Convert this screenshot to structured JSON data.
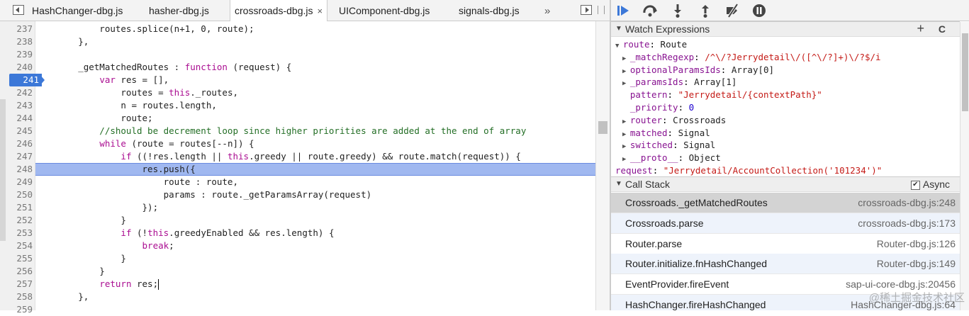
{
  "tabs": [
    {
      "label": "HashChanger-dbg.js",
      "active": false
    },
    {
      "label": "hasher-dbg.js",
      "active": false
    },
    {
      "label": "crossroads-dbg.js",
      "active": true
    },
    {
      "label": "UIComponent-dbg.js",
      "active": false
    },
    {
      "label": "signals-dbg.js",
      "active": false
    }
  ],
  "tab_close": "×",
  "tab_overflow": "»",
  "breakpoint_line": "241",
  "current_line": "248",
  "code": {
    "lines": [
      {
        "n": "237",
        "segs": [
          [
            "",
            "            routes.splice(n+1, 0, route);"
          ]
        ]
      },
      {
        "n": "238",
        "segs": [
          [
            "",
            "        },"
          ]
        ]
      },
      {
        "n": "239",
        "segs": [
          [
            "",
            ""
          ]
        ]
      },
      {
        "n": "240",
        "segs": [
          [
            "",
            "        _getMatchedRoutes : "
          ],
          [
            "kw",
            "function"
          ],
          [
            "",
            " (request) {"
          ]
        ]
      },
      {
        "n": "241",
        "segs": [
          [
            "",
            "            "
          ],
          [
            "kw",
            "var"
          ],
          [
            "",
            " res = [],"
          ]
        ]
      },
      {
        "n": "242",
        "segs": [
          [
            "",
            "                routes = "
          ],
          [
            "kw",
            "this"
          ],
          [
            "",
            "._routes,"
          ]
        ]
      },
      {
        "n": "243",
        "segs": [
          [
            "",
            "                n = routes.length,"
          ]
        ]
      },
      {
        "n": "244",
        "segs": [
          [
            "",
            "                route;"
          ]
        ]
      },
      {
        "n": "245",
        "segs": [
          [
            "cm",
            "            //should be decrement loop since higher priorities are added at the end of array"
          ]
        ]
      },
      {
        "n": "246",
        "segs": [
          [
            "",
            "            "
          ],
          [
            "kw",
            "while"
          ],
          [
            "",
            " (route = routes[--n]) {"
          ]
        ]
      },
      {
        "n": "247",
        "segs": [
          [
            "",
            "                "
          ],
          [
            "kw",
            "if"
          ],
          [
            "",
            " ((!res.length || "
          ],
          [
            "kw",
            "this"
          ],
          [
            "",
            ".greedy || route.greedy) && route.match(request)) {"
          ]
        ]
      },
      {
        "n": "248",
        "segs": [
          [
            "",
            "                    res.push({"
          ]
        ]
      },
      {
        "n": "249",
        "segs": [
          [
            "",
            "                        route : route,"
          ]
        ]
      },
      {
        "n": "250",
        "segs": [
          [
            "",
            "                        params : route._getParamsArray(request)"
          ]
        ]
      },
      {
        "n": "251",
        "segs": [
          [
            "",
            "                    });"
          ]
        ]
      },
      {
        "n": "252",
        "segs": [
          [
            "",
            "                }"
          ]
        ]
      },
      {
        "n": "253",
        "segs": [
          [
            "",
            "                "
          ],
          [
            "kw",
            "if"
          ],
          [
            "",
            " (!"
          ],
          [
            "kw",
            "this"
          ],
          [
            "",
            ".greedyEnabled && res.length) {"
          ]
        ]
      },
      {
        "n": "254",
        "segs": [
          [
            "",
            "                    "
          ],
          [
            "kw",
            "break"
          ],
          [
            "",
            ";"
          ]
        ]
      },
      {
        "n": "255",
        "segs": [
          [
            "",
            "                }"
          ]
        ]
      },
      {
        "n": "256",
        "segs": [
          [
            "",
            "            }"
          ]
        ]
      },
      {
        "n": "257",
        "segs": [
          [
            "",
            "            "
          ],
          [
            "kw",
            "return"
          ],
          [
            "",
            " res;"
          ]
        ]
      },
      {
        "n": "258",
        "segs": [
          [
            "",
            "        },"
          ]
        ]
      },
      {
        "n": "259",
        "segs": [
          [
            "",
            ""
          ]
        ]
      }
    ]
  },
  "debugger_buttons": [
    {
      "name": "resume-button",
      "icon": "resume-icon"
    },
    {
      "name": "step-over-button",
      "icon": "step-over-icon"
    },
    {
      "name": "step-into-button",
      "icon": "step-into-icon"
    },
    {
      "name": "step-out-button",
      "icon": "step-out-icon"
    },
    {
      "name": "deactivate-breakpoints-button",
      "icon": "deactivate-breakpoints-icon"
    },
    {
      "name": "pause-on-exceptions-button",
      "icon": "pause-icon"
    }
  ],
  "watch": {
    "title": "Watch Expressions",
    "add": "+",
    "refresh": "C",
    "items": [
      {
        "indent": 0,
        "arrow": "▼",
        "name": "route",
        "sep": ": ",
        "value": "Route",
        "vtype": "ov"
      },
      {
        "indent": 1,
        "arrow": "▶",
        "name": "_matchRegexp",
        "sep": ": ",
        "value": "/^\\/?Jerrydetail\\/([^\\/?]+)\\/?$/i",
        "vtype": "sv"
      },
      {
        "indent": 1,
        "arrow": "▶",
        "name": "optionalParamsIds",
        "sep": ": ",
        "value": "Array[0]",
        "vtype": "ov"
      },
      {
        "indent": 1,
        "arrow": "▶",
        "name": "_paramsIds",
        "sep": ": ",
        "value": "Array[1]",
        "vtype": "ov"
      },
      {
        "indent": 1,
        "arrow": "",
        "name": "pattern",
        "sep": ": ",
        "value": "\"Jerrydetail/{contextPath}\"",
        "vtype": "sv"
      },
      {
        "indent": 1,
        "arrow": "",
        "name": "_priority",
        "sep": ": ",
        "value": "0",
        "vtype": "nv"
      },
      {
        "indent": 1,
        "arrow": "▶",
        "name": "router",
        "sep": ": ",
        "value": "Crossroads",
        "vtype": "ov"
      },
      {
        "indent": 1,
        "arrow": "▶",
        "name": "matched",
        "sep": ": ",
        "value": "Signal",
        "vtype": "ov"
      },
      {
        "indent": 1,
        "arrow": "▶",
        "name": "switched",
        "sep": ": ",
        "value": "Signal",
        "vtype": "ov"
      },
      {
        "indent": 1,
        "arrow": "▶",
        "name": "__proto__",
        "sep": ": ",
        "value": "Object",
        "vtype": "ov"
      },
      {
        "indent": 0,
        "arrow": "",
        "name": "request",
        "sep": ": ",
        "value": "\"Jerrydetail/AccountCollection('101234')\"",
        "vtype": "sv"
      }
    ]
  },
  "callstack": {
    "title": "Call Stack",
    "async_label": "Async",
    "async_checked": true,
    "frames": [
      {
        "fn": "Crossroads._getMatchedRoutes",
        "loc": "crossroads-dbg.js:248",
        "selected": true
      },
      {
        "fn": "Crossroads.parse",
        "loc": "crossroads-dbg.js:173",
        "selected": false
      },
      {
        "fn": "Router.parse",
        "loc": "Router-dbg.js:126",
        "selected": false
      },
      {
        "fn": "Router.initialize.fnHashChanged",
        "loc": "Router-dbg.js:149",
        "selected": false
      },
      {
        "fn": "EventProvider.fireEvent",
        "loc": "sap-ui-core-dbg.js:20456",
        "selected": false
      },
      {
        "fn": "HashChanger.fireHashChanged",
        "loc": "HashChanger-dbg.js:64",
        "selected": false
      }
    ]
  },
  "watermark": "@稀土掘金技术社区"
}
